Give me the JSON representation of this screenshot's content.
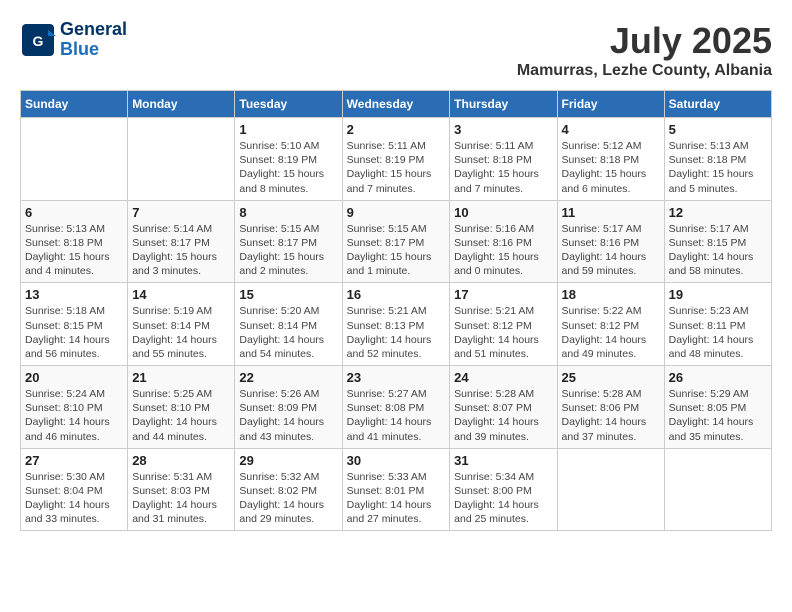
{
  "header": {
    "logo_line1": "General",
    "logo_line2": "Blue",
    "month_title": "July 2025",
    "subtitle": "Mamurras, Lezhe County, Albania"
  },
  "weekdays": [
    "Sunday",
    "Monday",
    "Tuesday",
    "Wednesday",
    "Thursday",
    "Friday",
    "Saturday"
  ],
  "weeks": [
    [
      {
        "day": "",
        "info": ""
      },
      {
        "day": "",
        "info": ""
      },
      {
        "day": "1",
        "info": "Sunrise: 5:10 AM\nSunset: 8:19 PM\nDaylight: 15 hours and 8 minutes."
      },
      {
        "day": "2",
        "info": "Sunrise: 5:11 AM\nSunset: 8:19 PM\nDaylight: 15 hours and 7 minutes."
      },
      {
        "day": "3",
        "info": "Sunrise: 5:11 AM\nSunset: 8:18 PM\nDaylight: 15 hours and 7 minutes."
      },
      {
        "day": "4",
        "info": "Sunrise: 5:12 AM\nSunset: 8:18 PM\nDaylight: 15 hours and 6 minutes."
      },
      {
        "day": "5",
        "info": "Sunrise: 5:13 AM\nSunset: 8:18 PM\nDaylight: 15 hours and 5 minutes."
      }
    ],
    [
      {
        "day": "6",
        "info": "Sunrise: 5:13 AM\nSunset: 8:18 PM\nDaylight: 15 hours and 4 minutes."
      },
      {
        "day": "7",
        "info": "Sunrise: 5:14 AM\nSunset: 8:17 PM\nDaylight: 15 hours and 3 minutes."
      },
      {
        "day": "8",
        "info": "Sunrise: 5:15 AM\nSunset: 8:17 PM\nDaylight: 15 hours and 2 minutes."
      },
      {
        "day": "9",
        "info": "Sunrise: 5:15 AM\nSunset: 8:17 PM\nDaylight: 15 hours and 1 minute."
      },
      {
        "day": "10",
        "info": "Sunrise: 5:16 AM\nSunset: 8:16 PM\nDaylight: 15 hours and 0 minutes."
      },
      {
        "day": "11",
        "info": "Sunrise: 5:17 AM\nSunset: 8:16 PM\nDaylight: 14 hours and 59 minutes."
      },
      {
        "day": "12",
        "info": "Sunrise: 5:17 AM\nSunset: 8:15 PM\nDaylight: 14 hours and 58 minutes."
      }
    ],
    [
      {
        "day": "13",
        "info": "Sunrise: 5:18 AM\nSunset: 8:15 PM\nDaylight: 14 hours and 56 minutes."
      },
      {
        "day": "14",
        "info": "Sunrise: 5:19 AM\nSunset: 8:14 PM\nDaylight: 14 hours and 55 minutes."
      },
      {
        "day": "15",
        "info": "Sunrise: 5:20 AM\nSunset: 8:14 PM\nDaylight: 14 hours and 54 minutes."
      },
      {
        "day": "16",
        "info": "Sunrise: 5:21 AM\nSunset: 8:13 PM\nDaylight: 14 hours and 52 minutes."
      },
      {
        "day": "17",
        "info": "Sunrise: 5:21 AM\nSunset: 8:12 PM\nDaylight: 14 hours and 51 minutes."
      },
      {
        "day": "18",
        "info": "Sunrise: 5:22 AM\nSunset: 8:12 PM\nDaylight: 14 hours and 49 minutes."
      },
      {
        "day": "19",
        "info": "Sunrise: 5:23 AM\nSunset: 8:11 PM\nDaylight: 14 hours and 48 minutes."
      }
    ],
    [
      {
        "day": "20",
        "info": "Sunrise: 5:24 AM\nSunset: 8:10 PM\nDaylight: 14 hours and 46 minutes."
      },
      {
        "day": "21",
        "info": "Sunrise: 5:25 AM\nSunset: 8:10 PM\nDaylight: 14 hours and 44 minutes."
      },
      {
        "day": "22",
        "info": "Sunrise: 5:26 AM\nSunset: 8:09 PM\nDaylight: 14 hours and 43 minutes."
      },
      {
        "day": "23",
        "info": "Sunrise: 5:27 AM\nSunset: 8:08 PM\nDaylight: 14 hours and 41 minutes."
      },
      {
        "day": "24",
        "info": "Sunrise: 5:28 AM\nSunset: 8:07 PM\nDaylight: 14 hours and 39 minutes."
      },
      {
        "day": "25",
        "info": "Sunrise: 5:28 AM\nSunset: 8:06 PM\nDaylight: 14 hours and 37 minutes."
      },
      {
        "day": "26",
        "info": "Sunrise: 5:29 AM\nSunset: 8:05 PM\nDaylight: 14 hours and 35 minutes."
      }
    ],
    [
      {
        "day": "27",
        "info": "Sunrise: 5:30 AM\nSunset: 8:04 PM\nDaylight: 14 hours and 33 minutes."
      },
      {
        "day": "28",
        "info": "Sunrise: 5:31 AM\nSunset: 8:03 PM\nDaylight: 14 hours and 31 minutes."
      },
      {
        "day": "29",
        "info": "Sunrise: 5:32 AM\nSunset: 8:02 PM\nDaylight: 14 hours and 29 minutes."
      },
      {
        "day": "30",
        "info": "Sunrise: 5:33 AM\nSunset: 8:01 PM\nDaylight: 14 hours and 27 minutes."
      },
      {
        "day": "31",
        "info": "Sunrise: 5:34 AM\nSunset: 8:00 PM\nDaylight: 14 hours and 25 minutes."
      },
      {
        "day": "",
        "info": ""
      },
      {
        "day": "",
        "info": ""
      }
    ]
  ]
}
